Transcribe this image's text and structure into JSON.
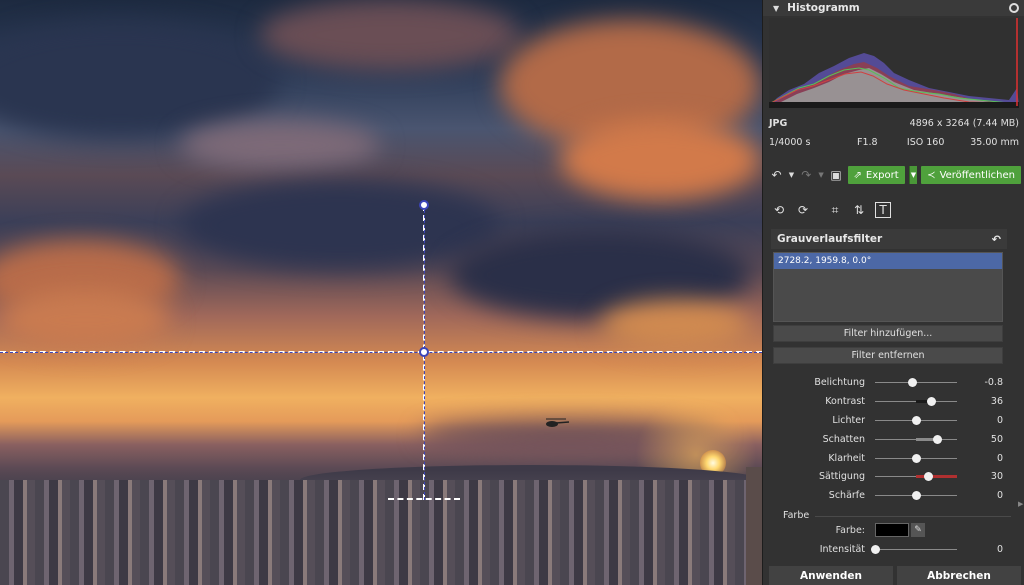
{
  "histogram": {
    "title": "Histogramm",
    "format": "JPG",
    "dimensions": "4896 x 3264 (7.44 MB)",
    "shutter": "1/4000 s",
    "aperture": "F1.8",
    "iso": "ISO 160",
    "focal": "35.00 mm"
  },
  "toolbar": {
    "export_label": "Export",
    "publish_label": "Veröffentlichen"
  },
  "filter": {
    "title": "Grauverlaufsfilter",
    "list_items": [
      "2728.2, 1959.8, 0.0°"
    ],
    "add_button": "Filter hinzufügen...",
    "remove_button": "Filter entfernen"
  },
  "sliders": [
    {
      "label": "Belichtung",
      "value": "-0.8",
      "level": 0.45,
      "fill": "#1a1a1a"
    },
    {
      "label": "Kontrast",
      "value": "36",
      "level": 0.68,
      "fill": "#1a1a1a"
    },
    {
      "label": "Lichter",
      "value": "0",
      "level": 0.5,
      "fill": "#8a8a8a"
    },
    {
      "label": "Schatten",
      "value": "50",
      "level": 0.75,
      "fill": "#8a8a8a"
    },
    {
      "label": "Klarheit",
      "value": "0",
      "level": 0.5,
      "fill": "#8a8a8a"
    },
    {
      "label": "Sättigung",
      "value": "30",
      "level": 0.65,
      "fill": "#b03030"
    },
    {
      "label": "Schärfe",
      "value": "0",
      "level": 0.5,
      "fill": "#8a8a8a"
    }
  ],
  "color_section": {
    "section_label": "Farbe",
    "color_label": "Farbe:",
    "color_value": "#000000",
    "intensity_label": "Intensität",
    "intensity_value": "0",
    "intensity_level": 0.0
  },
  "actions": {
    "apply": "Anwenden",
    "cancel": "Abbrechen"
  },
  "colors": {
    "accent_green": "#4fa13c",
    "selection_blue": "#4c68a6",
    "guide_blue": "#3b44b8"
  }
}
